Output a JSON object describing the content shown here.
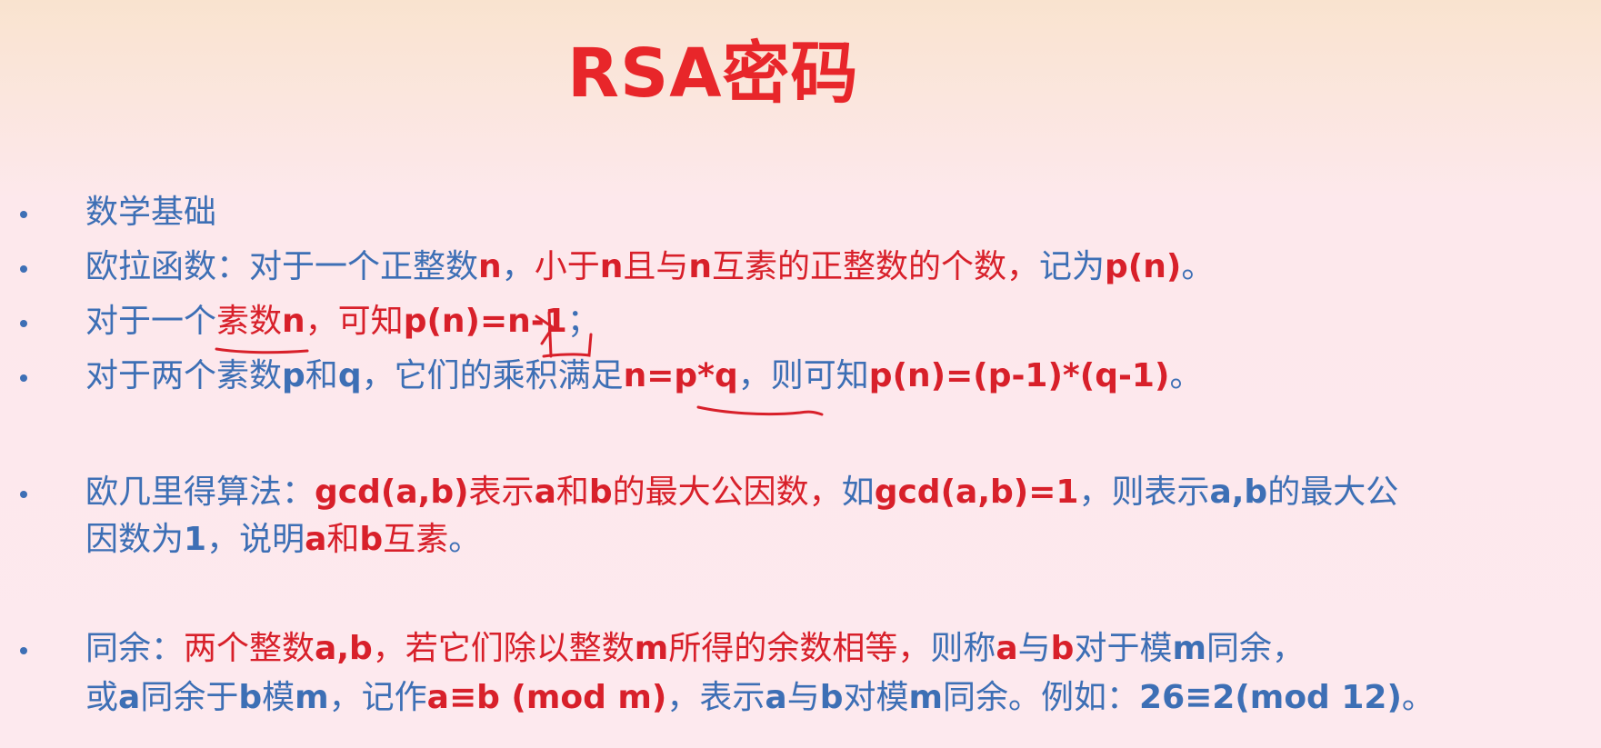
{
  "title": "RSA密码",
  "items": {
    "basics": "数学基础",
    "euler": {
      "label": "欧拉函数：",
      "t1": "对于一个正整数",
      "t2": "n",
      "t3": "，",
      "t4": "小于",
      "t5": "n",
      "t6": "且与",
      "t7": "n",
      "t8": "互素的正整数的个数，",
      "t9": "记为",
      "t10": "p(n)",
      "t11": "。"
    },
    "prime": {
      "t1": "对于一个",
      "t2": "素数",
      "t3": "n",
      "t4": "，可知",
      "t5": "p(n)=n-1",
      "t6": "；"
    },
    "two_primes": {
      "t1": "对于两个素数",
      "t2": "p",
      "t3": "和",
      "t4": "q",
      "t5": "，它们的乘积满足",
      "t6": "n=p*q",
      "t7": "，则可知",
      "t8": "p(n)=(p-1)*(q-1)",
      "t9": "。"
    },
    "euclid": {
      "line1": {
        "t1": "欧几里得算法：",
        "t2": "gcd(a,b)",
        "t3": "表示",
        "t4": "a",
        "t5": "和",
        "t6": "b",
        "t7": "的最大公因数，",
        "t8": "如",
        "t9": "gcd(a,b)=1",
        "t10": "，则表示",
        "t11": "a,b",
        "t12": "的最大公"
      },
      "line2": {
        "t1": "因数为",
        "t2": "1",
        "t3": "，说明",
        "t4": "a",
        "t5": "和",
        "t6": "b",
        "t7": "互素",
        "t8": "。"
      }
    },
    "congruence": {
      "line1": {
        "t1": "同余：",
        "t2": "两个整数",
        "t3": "a,b",
        "t4": "，若它们除以整数",
        "t5": "m",
        "t6": "所得的余数相等，",
        "t7": "则称",
        "t8": "a",
        "t9": "与",
        "t10": "b",
        "t11": "对于模",
        "t12": "m",
        "t13": "同余，"
      },
      "line2": {
        "t1": "或",
        "t2": "a",
        "t3": "同余于",
        "t4": "b",
        "t5": "模",
        "t6": "m",
        "t7": "，记作",
        "t8": "a≡b (mod m)",
        "t9": "，表示",
        "t10": "a",
        "t11": "与",
        "t12": "b",
        "t13": "对模",
        "t14": "m",
        "t15": "同余。例如：",
        "t16": "26≡2(mod 12)",
        "t17": "。"
      }
    }
  },
  "colors": {
    "title": "#e8262a",
    "text_blue": "#3d6fb5",
    "text_red": "#d8202a",
    "annotation": "#d8202a"
  }
}
